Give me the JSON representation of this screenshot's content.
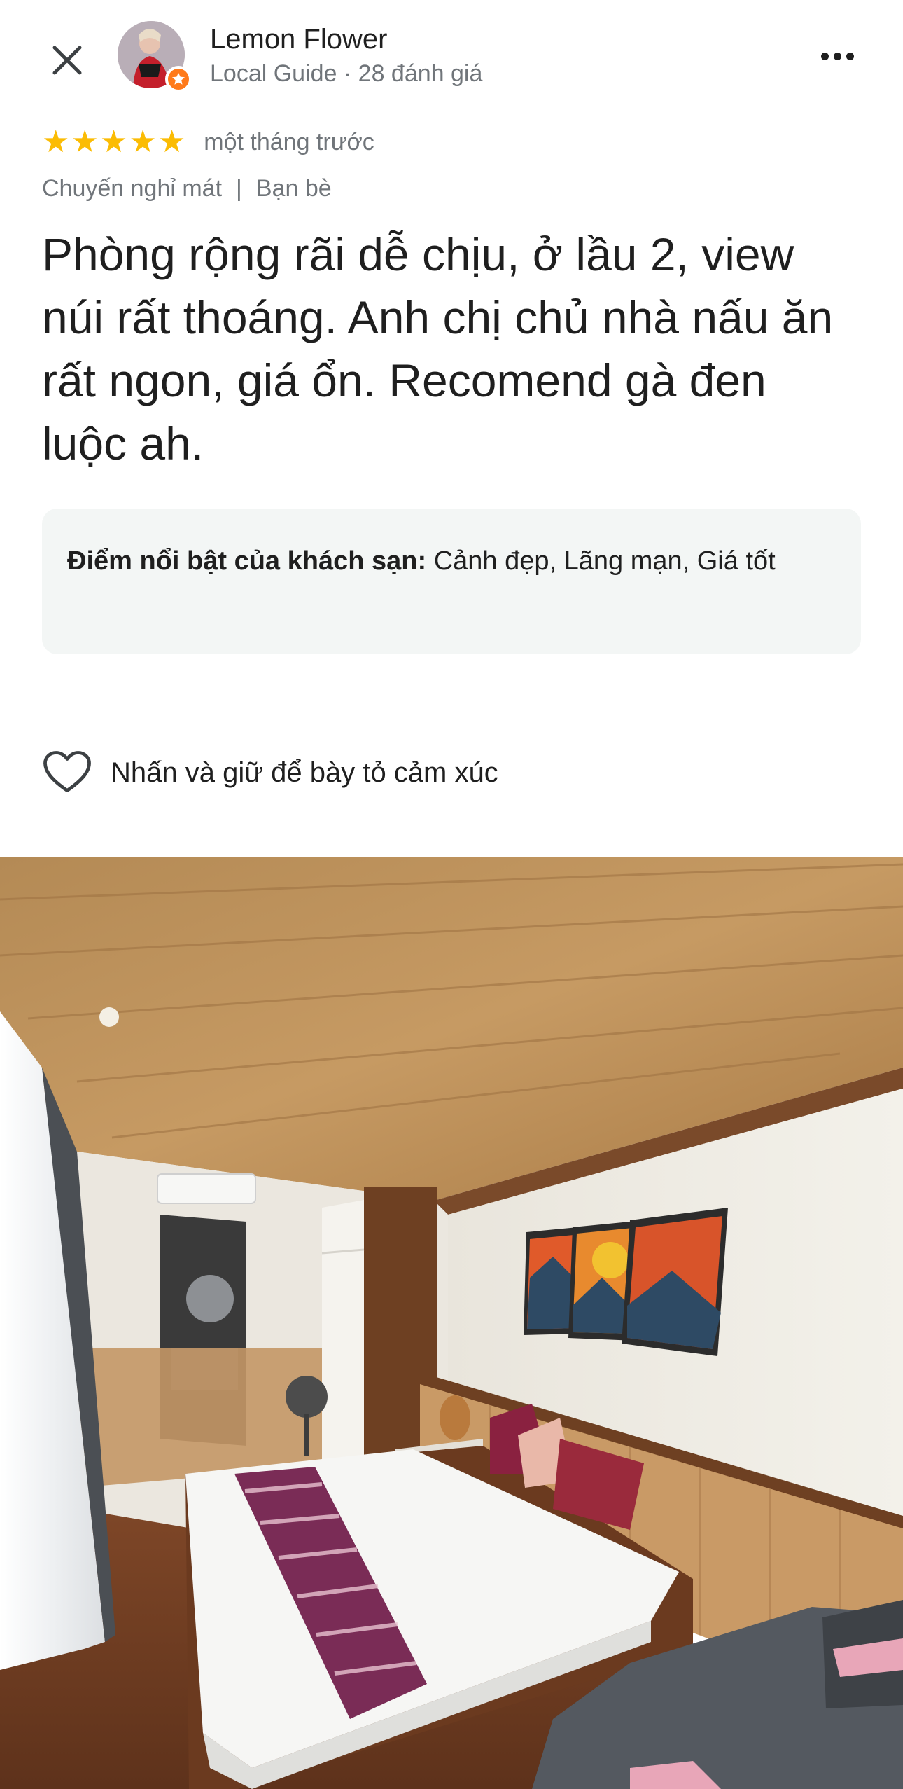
{
  "header": {
    "author_name": "Lemon Flower",
    "author_meta": "Local Guide · 28 đánh giá"
  },
  "review": {
    "stars": 5,
    "time": "một tháng trước",
    "trip_type": "Chuyến nghỉ mát",
    "companions": "Bạn bè",
    "separator": "|",
    "text": "Phòng rộng rãi dễ chịu, ở lầu 2, view núi rất thoáng. Anh chị chủ nhà nấu ăn rất ngon, giá ổn. Recomend gà đen luộc ah.",
    "highlights_label": "Điểm nổi bật của khách sạn:",
    "highlights_value": " Cảnh đẹp, Lãng mạn, Giá tốt"
  },
  "reactions": {
    "hint": "Nhấn và giữ để bày tỏ cảm xúc"
  },
  "colors": {
    "star": "#fbbc04",
    "badge": "#ff7a1a",
    "highlight_bg": "#f3f6f5",
    "muted_text": "#70757a"
  },
  "icons": [
    "close-icon",
    "local-guide-badge-icon",
    "more-options-icon",
    "star-icon",
    "heart-icon"
  ]
}
